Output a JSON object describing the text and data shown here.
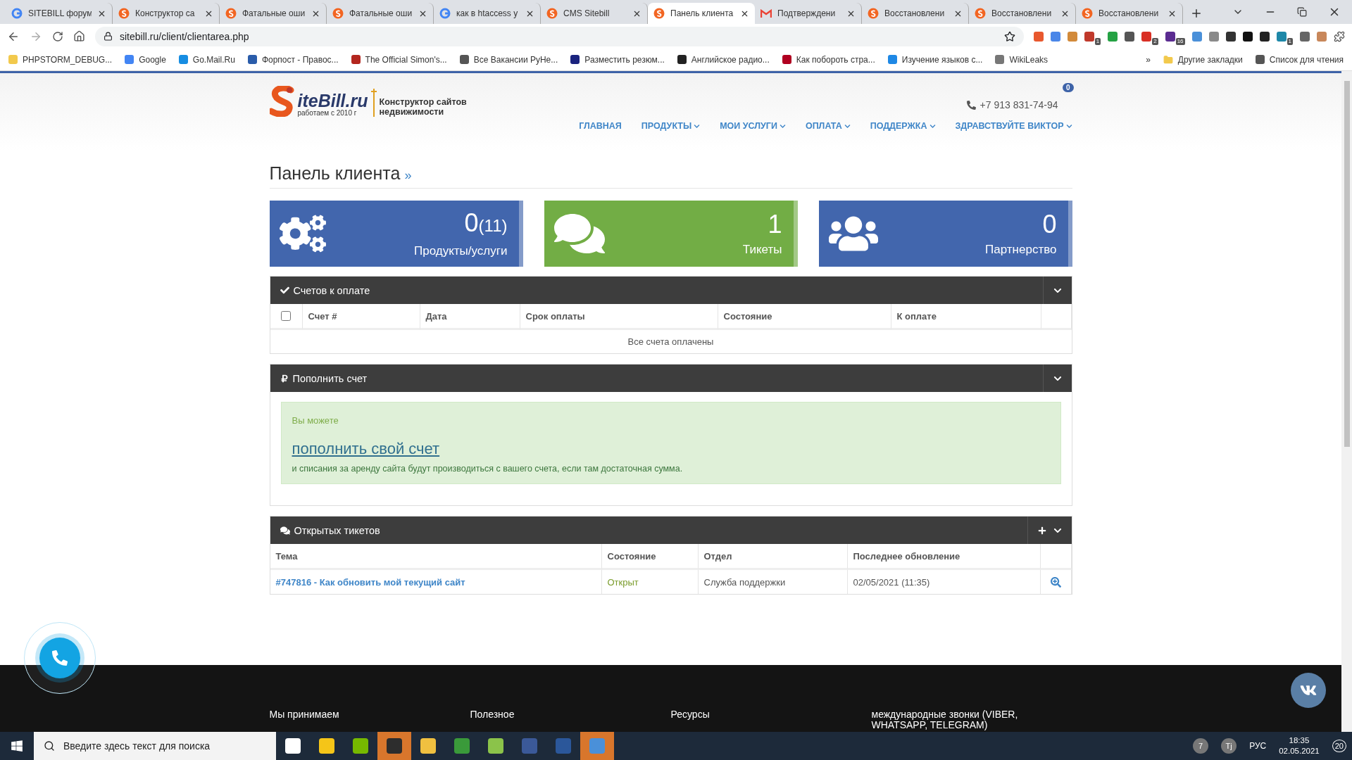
{
  "browser": {
    "tabs": [
      {
        "title": "SITEBILL форум",
        "kind": "google",
        "selected": false
      },
      {
        "title": "Конструктор са",
        "kind": "sitebill",
        "selected": false
      },
      {
        "title": "Фатальные оши",
        "kind": "sitebill",
        "selected": false
      },
      {
        "title": "Фатальные оши",
        "kind": "sitebill",
        "selected": false
      },
      {
        "title": "как в htaccess у",
        "kind": "google",
        "selected": false
      },
      {
        "title": "CMS Sitebill",
        "kind": "sitebill",
        "selected": false
      },
      {
        "title": "Панель клиента",
        "kind": "sitebill",
        "selected": true
      },
      {
        "title": "Подтверждени",
        "kind": "gmail",
        "selected": false
      },
      {
        "title": "Восстановлени",
        "kind": "sitebill",
        "selected": false
      },
      {
        "title": "Восстановлени",
        "kind": "sitebill",
        "selected": false
      },
      {
        "title": "Восстановлени",
        "kind": "sitebill",
        "selected": false
      }
    ],
    "address": "sitebill.ru/client/clientarea.php",
    "extensions": [
      {
        "color": "#e8582e"
      },
      {
        "color": "#4a86e8"
      },
      {
        "color": "#d28a3a"
      },
      {
        "color": "#c0392b",
        "badge": "1"
      },
      {
        "color": "#25a244"
      },
      {
        "color": "#555555"
      },
      {
        "color": "#d93025",
        "badge": "2"
      },
      {
        "color": "#5b2c91",
        "badge": "16"
      },
      {
        "color": "#4a90d9"
      },
      {
        "color": "#8a8a8a"
      },
      {
        "color": "#333333"
      },
      {
        "color": "#111111"
      },
      {
        "color": "#222222"
      },
      {
        "color": "#1e88a8",
        "badge": "1"
      },
      {
        "color": "#666666"
      },
      {
        "color": "#c8875a"
      }
    ],
    "bookmarks": [
      {
        "label": "PHPSTORM_DEBUG...",
        "color": "#f2c94c"
      },
      {
        "label": "Google",
        "color": "#4285f4"
      },
      {
        "label": "Go.Mail.Ru",
        "color": "#168de2"
      },
      {
        "label": "Форпост - Правос...",
        "color": "#2a5caa"
      },
      {
        "label": "The Official Simon's...",
        "color": "#b3261e"
      },
      {
        "label": "Все Вакансии РуНе...",
        "color": "#555555"
      },
      {
        "label": "Разместить резюм...",
        "color": "#1a237e"
      },
      {
        "label": "Английское радио...",
        "color": "#222222"
      },
      {
        "label": "Как побороть стра...",
        "color": "#b00020"
      },
      {
        "label": "Изучение языков с...",
        "color": "#1e88e5"
      },
      {
        "label": "WikiLeaks",
        "color": "#777777"
      }
    ],
    "overflow": "»",
    "other_bookmarks": "Другие закладки",
    "reading_list": "Список для чтения"
  },
  "site": {
    "logo": {
      "name": "iteBill.ru",
      "tagline": "работаем с 2010 г",
      "subtitle_1": "Конструктор сайтов",
      "subtitle_2": "недвижимости"
    },
    "phone": "+7 913 831-74-94",
    "cart_count": "0",
    "nav": [
      {
        "label": "ГЛАВНАЯ",
        "dropdown": false
      },
      {
        "label": "ПРОДУКТЫ",
        "dropdown": true
      },
      {
        "label": "МОИ УСЛУГИ",
        "dropdown": true
      },
      {
        "label": "ОПЛАТА",
        "dropdown": true
      },
      {
        "label": "ПОДДЕРЖКА",
        "dropdown": true
      },
      {
        "label": "ЗДРАВСТВУЙТЕ ВИКТОР",
        "dropdown": true
      }
    ],
    "page_title": "Панель клиента",
    "title_mark": "»"
  },
  "tiles": [
    {
      "kind": "gears",
      "count": "0",
      "extra": "(11)",
      "label": "Продукты/услуги",
      "color": "#4266ad"
    },
    {
      "kind": "chat",
      "count": "1",
      "label": "Тикеты",
      "color": "#72ad45"
    },
    {
      "kind": "users",
      "count": "0",
      "label": "Партнерство",
      "color": "#4266ad"
    }
  ],
  "invoices": {
    "title": "Счетов к оплате",
    "select_all": {
      "checked": false
    },
    "columns": [
      "Счет #",
      "Дата",
      "Срок оплаты",
      "Состояние",
      "К оплате"
    ],
    "empty": "Все счета оплачены"
  },
  "topup": {
    "title": "Пополнить счет",
    "intro": "Вы можете",
    "link": "пополнить свой счет",
    "text": "и списания за аренду сайта будут производиться с вашего счета, если там достаточная сумма."
  },
  "tickets": {
    "title": "Открытых тикетов",
    "columns": [
      "Тема",
      "Состояние",
      "Отдел",
      "Последнее обновление"
    ],
    "rows": [
      {
        "subject": "#747816 - Как обновить мой текущий сайт",
        "status": "Открыт",
        "department": "Служба поддержки",
        "updated": "02/05/2021 (11:35)"
      }
    ]
  },
  "footer": [
    "Мы принимаем",
    "Полезное",
    "Ресурсы",
    "международные звонки (VIBER, WHATSAPP, TELEGRAM)"
  ],
  "taskbar": {
    "search_placeholder": "Введите здесь текст для поиска",
    "apps": [
      {
        "color": "#ffffff",
        "flashing": false
      },
      {
        "color": "#f5c518",
        "flashing": false
      },
      {
        "color": "#76b900",
        "flashing": false
      },
      {
        "color": "#2d2d2d",
        "flashing": true
      },
      {
        "color": "#f0c040",
        "flashing": false
      },
      {
        "color": "#3a9a3a",
        "flashing": false
      },
      {
        "color": "#8bc34a",
        "flashing": false
      },
      {
        "color": "#3b5998",
        "flashing": false
      },
      {
        "color": "#2b579a",
        "flashing": false
      },
      {
        "color": "#4a90d9",
        "flashing": true
      }
    ],
    "tray_badges": [
      "7",
      "Tj"
    ],
    "language": "РУС",
    "time": "18:35",
    "date": "02.05.2021",
    "notifications": "20"
  }
}
